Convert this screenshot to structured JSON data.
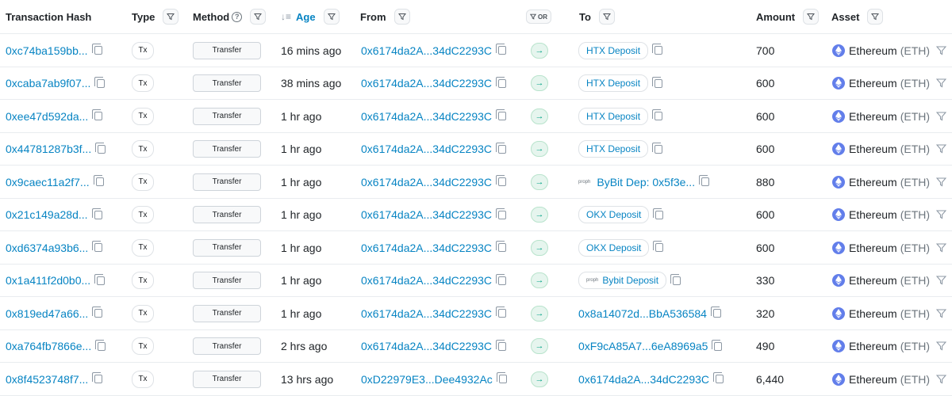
{
  "headers": {
    "hash": "Transaction Hash",
    "type": "Type",
    "method": "Method",
    "age": "Age",
    "from": "From",
    "or": "OR",
    "to": "To",
    "amount": "Amount",
    "asset": "Asset"
  },
  "colors": {
    "link": "#0784c3",
    "eth": "#627eea",
    "in_arrow": "#00a186"
  },
  "rows": [
    {
      "hash": "0xc74ba159bb...",
      "type": "Tx",
      "method": "Transfer",
      "age": "16 mins ago",
      "from": "0x6174da2A...34dC2293C",
      "to": "HTX Deposit",
      "to_style": "pill",
      "to_tag": "",
      "amount": "700",
      "asset": "Ethereum",
      "asset_symbol": "(ETH)"
    },
    {
      "hash": "0xcaba7ab9f07...",
      "type": "Tx",
      "method": "Transfer",
      "age": "38 mins ago",
      "from": "0x6174da2A...34dC2293C",
      "to": "HTX Deposit",
      "to_style": "pill",
      "to_tag": "",
      "amount": "600",
      "asset": "Ethereum",
      "asset_symbol": "(ETH)"
    },
    {
      "hash": "0xee47d592da...",
      "type": "Tx",
      "method": "Transfer",
      "age": "1 hr ago",
      "from": "0x6174da2A...34dC2293C",
      "to": "HTX Deposit",
      "to_style": "pill",
      "to_tag": "",
      "amount": "600",
      "asset": "Ethereum",
      "asset_symbol": "(ETH)"
    },
    {
      "hash": "0x44781287b3f...",
      "type": "Tx",
      "method": "Transfer",
      "age": "1 hr ago",
      "from": "0x6174da2A...34dC2293C",
      "to": "HTX Deposit",
      "to_style": "pill",
      "to_tag": "",
      "amount": "600",
      "asset": "Ethereum",
      "asset_symbol": "(ETH)"
    },
    {
      "hash": "0x9caec11a2f7...",
      "type": "Tx",
      "method": "Transfer",
      "age": "1 hr ago",
      "from": "0x6174da2A...34dC2293C",
      "to": "ByBit Dep: 0x5f3e...",
      "to_style": "plain-tag",
      "to_tag": "proph",
      "amount": "880",
      "asset": "Ethereum",
      "asset_symbol": "(ETH)"
    },
    {
      "hash": "0x21c149a28d...",
      "type": "Tx",
      "method": "Transfer",
      "age": "1 hr ago",
      "from": "0x6174da2A...34dC2293C",
      "to": "OKX Deposit",
      "to_style": "pill",
      "to_tag": "",
      "amount": "600",
      "asset": "Ethereum",
      "asset_symbol": "(ETH)"
    },
    {
      "hash": "0xd6374a93b6...",
      "type": "Tx",
      "method": "Transfer",
      "age": "1 hr ago",
      "from": "0x6174da2A...34dC2293C",
      "to": "OKX Deposit",
      "to_style": "pill",
      "to_tag": "",
      "amount": "600",
      "asset": "Ethereum",
      "asset_symbol": "(ETH)"
    },
    {
      "hash": "0x1a411f2d0b0...",
      "type": "Tx",
      "method": "Transfer",
      "age": "1 hr ago",
      "from": "0x6174da2A...34dC2293C",
      "to": "Bybit Deposit",
      "to_style": "pill",
      "to_tag": "proph",
      "amount": "330",
      "asset": "Ethereum",
      "asset_symbol": "(ETH)"
    },
    {
      "hash": "0x819ed47a66...",
      "type": "Tx",
      "method": "Transfer",
      "age": "1 hr ago",
      "from": "0x6174da2A...34dC2293C",
      "to": "0x8a14072d...BbA536584",
      "to_style": "plain",
      "to_tag": "",
      "amount": "320",
      "asset": "Ethereum",
      "asset_symbol": "(ETH)"
    },
    {
      "hash": "0xa764fb7866e...",
      "type": "Tx",
      "method": "Transfer",
      "age": "2 hrs ago",
      "from": "0x6174da2A...34dC2293C",
      "to": "0xF9cA85A7...6eA8969a5",
      "to_style": "plain",
      "to_tag": "",
      "amount": "490",
      "asset": "Ethereum",
      "asset_symbol": "(ETH)"
    },
    {
      "hash": "0x8f4523748f7...",
      "type": "Tx",
      "method": "Transfer",
      "age": "13 hrs ago",
      "from": "0xD22979E3...Dee4932Ac",
      "to": "0x6174da2A...34dC2293C",
      "to_style": "plain",
      "to_tag": "",
      "amount": "6,440",
      "asset": "Ethereum",
      "asset_symbol": "(ETH)"
    }
  ]
}
